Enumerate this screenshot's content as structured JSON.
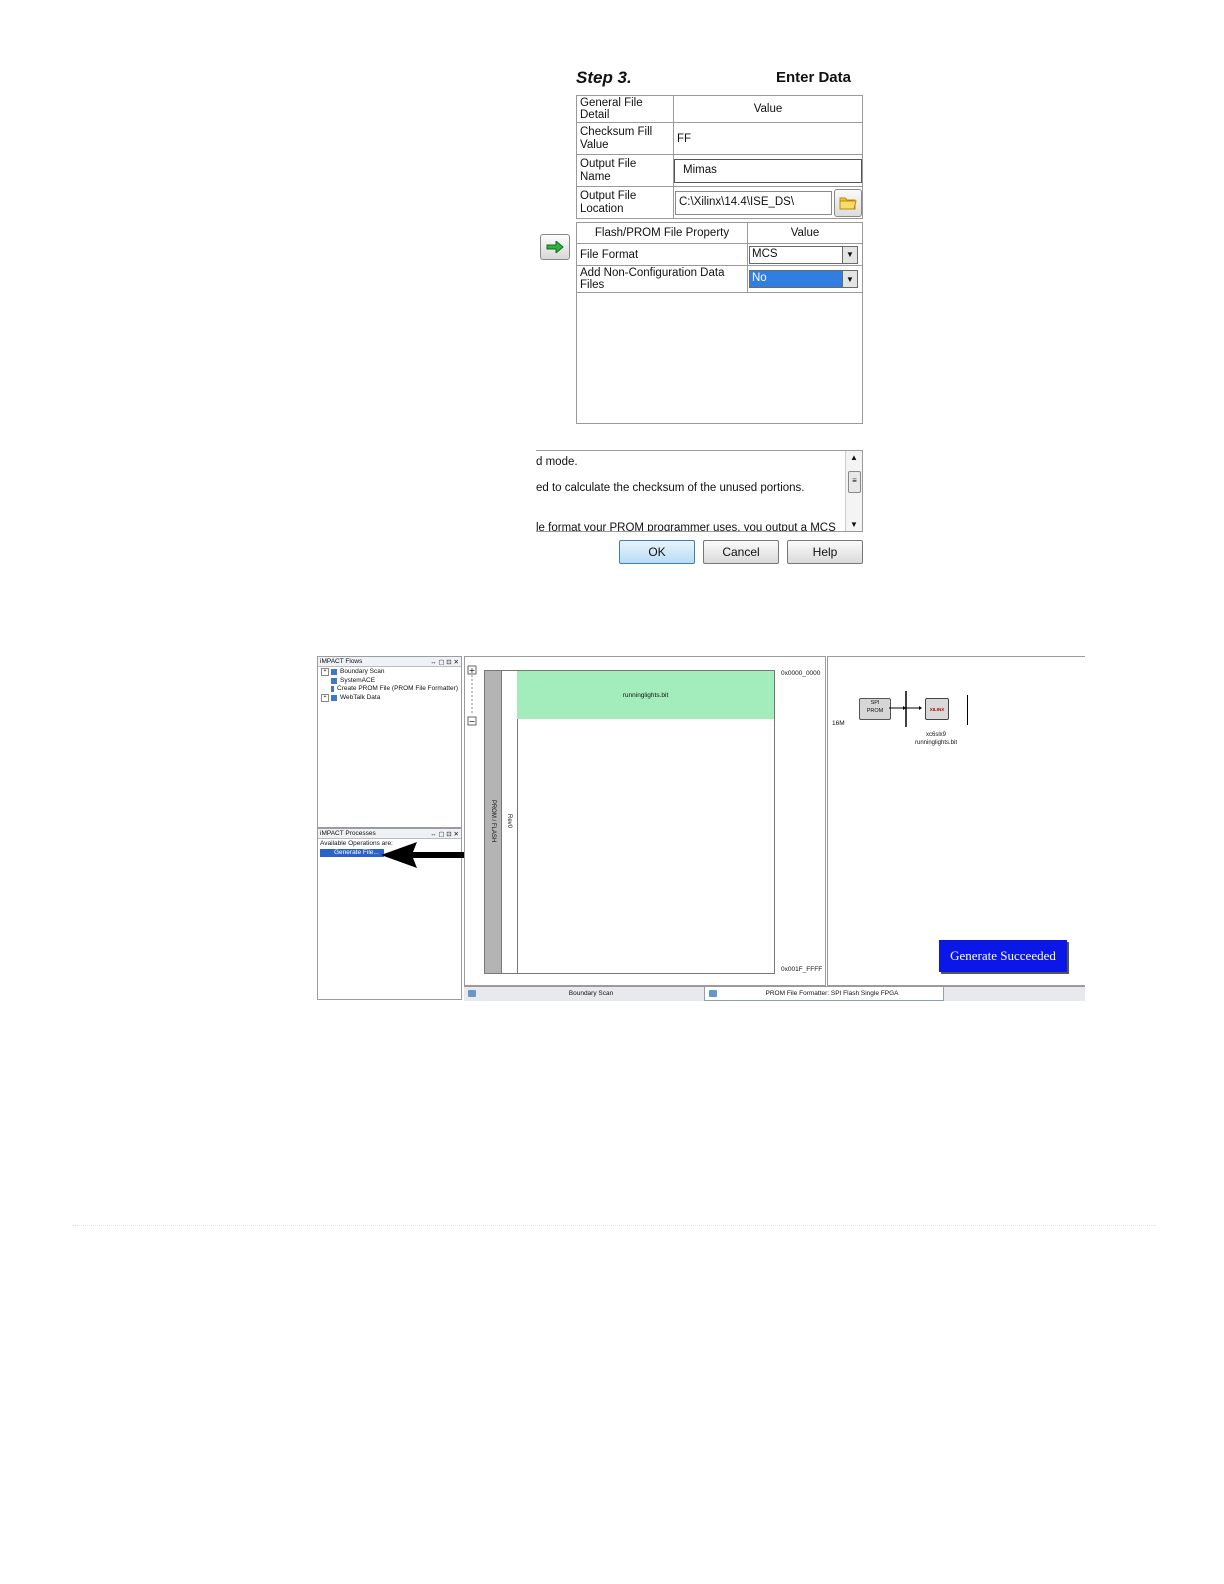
{
  "dialog": {
    "step_title": "Step 3.",
    "heading": "Enter Data",
    "general": {
      "col1": "General File Detail",
      "col2": "Value",
      "rows": [
        {
          "label": "Checksum Fill Value",
          "value": "FF"
        },
        {
          "label": "Output File Name",
          "value": "Mimas"
        },
        {
          "label": "Output File Location",
          "value": "C:\\Xilinx\\14.4\\ISE_DS\\"
        }
      ]
    },
    "flash": {
      "col1": "Flash/PROM File Property",
      "col2": "Value",
      "rows": [
        {
          "label": "File Format",
          "value": "MCS"
        },
        {
          "label": "Add Non-Configuration Data Files",
          "value": "No"
        }
      ]
    },
    "description": [
      "d mode.",
      "ed to calculate the checksum of the unused portions.",
      "le format your PROM programmer uses, you output a MCS"
    ],
    "buttons": {
      "ok": "OK",
      "cancel": "Cancel",
      "help": "Help"
    }
  },
  "impact": {
    "flows_title": "iMPACT Flows",
    "flows": [
      "Boundary Scan",
      "SystemACE",
      "Create PROM File (PROM File Formatter)",
      "WebTalk Data"
    ],
    "processes_title": "iMPACT Processes",
    "processes_caption": "Available Operations are:",
    "process_item": "Generate File...",
    "pane_controls": "↔ ▢ ⊡ ✕",
    "prom_label": "PROM / FLASH",
    "rev_label": "Rev0",
    "bitfile": "runninglights.bit",
    "addr_start": "0x0000_0000",
    "addr_end": "0x001F_FFFF",
    "size_label": "16M",
    "spi_label": "SPI",
    "prom_sub": "PROM",
    "xilinx_label": "XILINX",
    "device_name": "xc6slx9",
    "device_file": "runninglights.bit",
    "generate_msg": "Generate Succeeded",
    "tabs": [
      "Boundary Scan",
      "PROM File Formatter: SPI Flash Single FPGA"
    ]
  },
  "colors": {
    "accent": "#0a17e6",
    "selection": "#2a63c7",
    "bit_region": "#a3ecbc",
    "ok_button": "#b9dcf6"
  }
}
